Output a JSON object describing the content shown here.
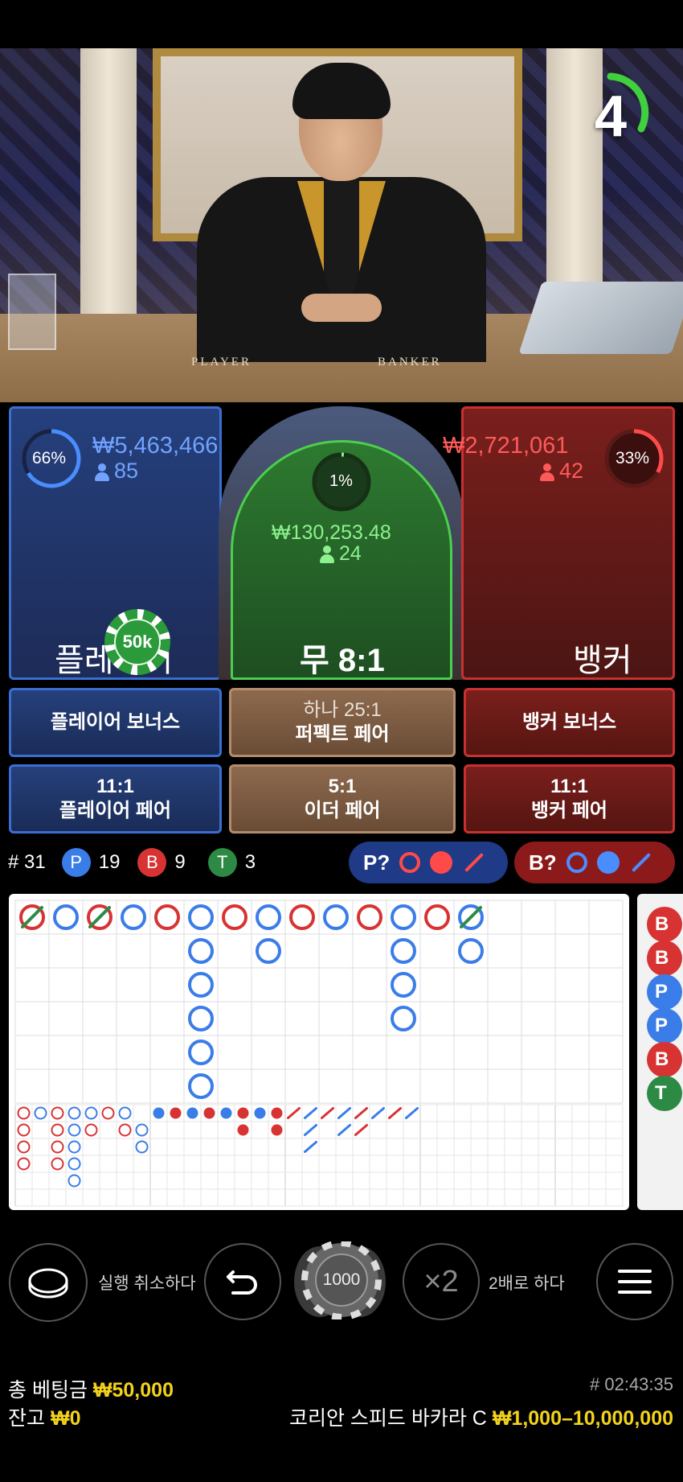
{
  "timer": {
    "seconds": "4"
  },
  "video": {
    "player_label": "PLAYER",
    "banker_label": "BANKER"
  },
  "bets": {
    "player": {
      "percent": "66%",
      "amount": "₩5,463,466",
      "players": "85",
      "name": "플레이어"
    },
    "tie": {
      "percent": "1%",
      "amount": "₩130,253.48",
      "players": "24",
      "name": "무 8:1"
    },
    "banker": {
      "percent": "33%",
      "amount": "₩2,721,061",
      "players": "42",
      "name": "뱅커"
    },
    "placed_chip": "50k"
  },
  "side_bets": {
    "player_bonus": "플레이어 보너스",
    "perfect_pair_odds": "하나 25:1",
    "perfect_pair": "퍼펙트 페어",
    "banker_bonus": "뱅커 보너스",
    "player_pair_odds": "11:1",
    "player_pair": "플레이어 페어",
    "either_pair_odds": "5:1",
    "either_pair": "이더 페어",
    "banker_pair_odds": "11:1",
    "banker_pair": "뱅커 페어"
  },
  "stats": {
    "round": "# 31",
    "p_letter": "P",
    "p_count": "19",
    "b_letter": "B",
    "b_count": "9",
    "t_letter": "T",
    "t_count": "3",
    "player_ask": "P?",
    "banker_ask": "B?"
  },
  "colors": {
    "player": "#3b7de8",
    "banker": "#d83333",
    "tie": "#2d8a45",
    "gold": "#f2d21c"
  },
  "road_side": [
    "B",
    "B",
    "P",
    "P",
    "B",
    "T"
  ],
  "bead_road": {
    "columns": [
      [
        "B"
      ],
      [
        "P"
      ],
      [
        "B"
      ],
      [
        "P"
      ],
      [
        "B"
      ],
      [
        "P",
        "P",
        "P",
        "P",
        "P",
        "P"
      ],
      [
        "B"
      ],
      [
        "P",
        "P"
      ],
      [
        "B"
      ],
      [
        "P"
      ],
      [
        "B"
      ],
      [
        "P",
        "P",
        "P",
        "P"
      ],
      [
        "B"
      ],
      [
        "P",
        "P"
      ]
    ],
    "tie_marks": [
      0,
      2,
      13
    ]
  },
  "controls": {
    "undo_label": "실행 취소하다",
    "chip_value": "1000",
    "double_symbol": "×2",
    "double_label": "2배로 하다"
  },
  "footer": {
    "total_bet_label": "총 베팅금",
    "total_bet_value": "₩50,000",
    "balance_label": "잔고",
    "balance_value": "₩0",
    "game_id": "# 02:43:35",
    "table_name": "코리안 스피드 바카라 C",
    "limits": "₩1,000–10,000,000"
  }
}
